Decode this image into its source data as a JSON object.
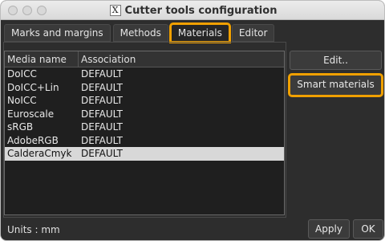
{
  "window": {
    "title": "Cutter tools configuration"
  },
  "tabs": [
    {
      "label": "Marks and margins"
    },
    {
      "label": "Methods"
    },
    {
      "label": "Materials",
      "active": true
    },
    {
      "label": "Editor"
    }
  ],
  "table": {
    "columns": [
      "Media name",
      "Association"
    ],
    "rows": [
      [
        "DoICC",
        "DEFAULT"
      ],
      [
        "DoICC+Lin",
        "DEFAULT"
      ],
      [
        "NoICC",
        "DEFAULT"
      ],
      [
        "Euroscale",
        "DEFAULT"
      ],
      [
        "sRGB",
        "DEFAULT"
      ],
      [
        "AdobeRGB",
        "DEFAULT"
      ],
      [
        "CalderaCmyk",
        "DEFAULT"
      ]
    ],
    "selected_row": "CalderaCmyk"
  },
  "side_buttons": {
    "edit": "Edit..",
    "smart_materials": "Smart materials"
  },
  "footer": {
    "units": "Units : mm",
    "apply": "Apply",
    "ok": "OK"
  },
  "colors": {
    "highlight": "#f0a000",
    "background": "#2d2d2d",
    "selected_row": "#d8d8d8"
  },
  "icons": [
    "x11-icon"
  ]
}
